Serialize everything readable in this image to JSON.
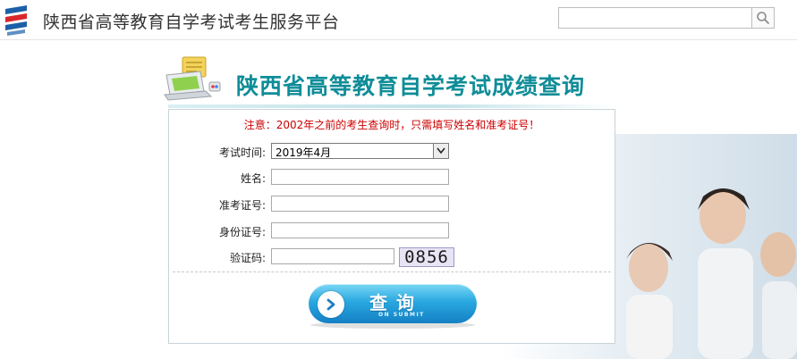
{
  "header": {
    "site_title": "陕西省高等教育自学考试考生服务平台",
    "search": {
      "value": "",
      "placeholder": "",
      "button_icon": "search-icon"
    }
  },
  "banner": {
    "title": "陕西省高等教育自学考试成绩查询",
    "icon": "computer-notepad-icon"
  },
  "form": {
    "notice": "注意：2002年之前的考生查询时，只需填写姓名和准考证号！",
    "exam_time": {
      "label": "考试时间:",
      "selected": "2019年4月"
    },
    "name": {
      "label": "姓名:",
      "value": ""
    },
    "ticket_no": {
      "label": "准考证号:",
      "value": ""
    },
    "id_no": {
      "label": "身份证号:",
      "value": ""
    },
    "captcha": {
      "label": "验证码:",
      "value": "",
      "image_text": "0856"
    },
    "submit": {
      "label": "查询",
      "sublabel": "ON SUBMIT",
      "icon": "chevron-right-icon"
    }
  },
  "colors": {
    "title_teal": "#0f8d98",
    "notice_red": "#cc0000",
    "button_blue": "#29a8e0"
  }
}
